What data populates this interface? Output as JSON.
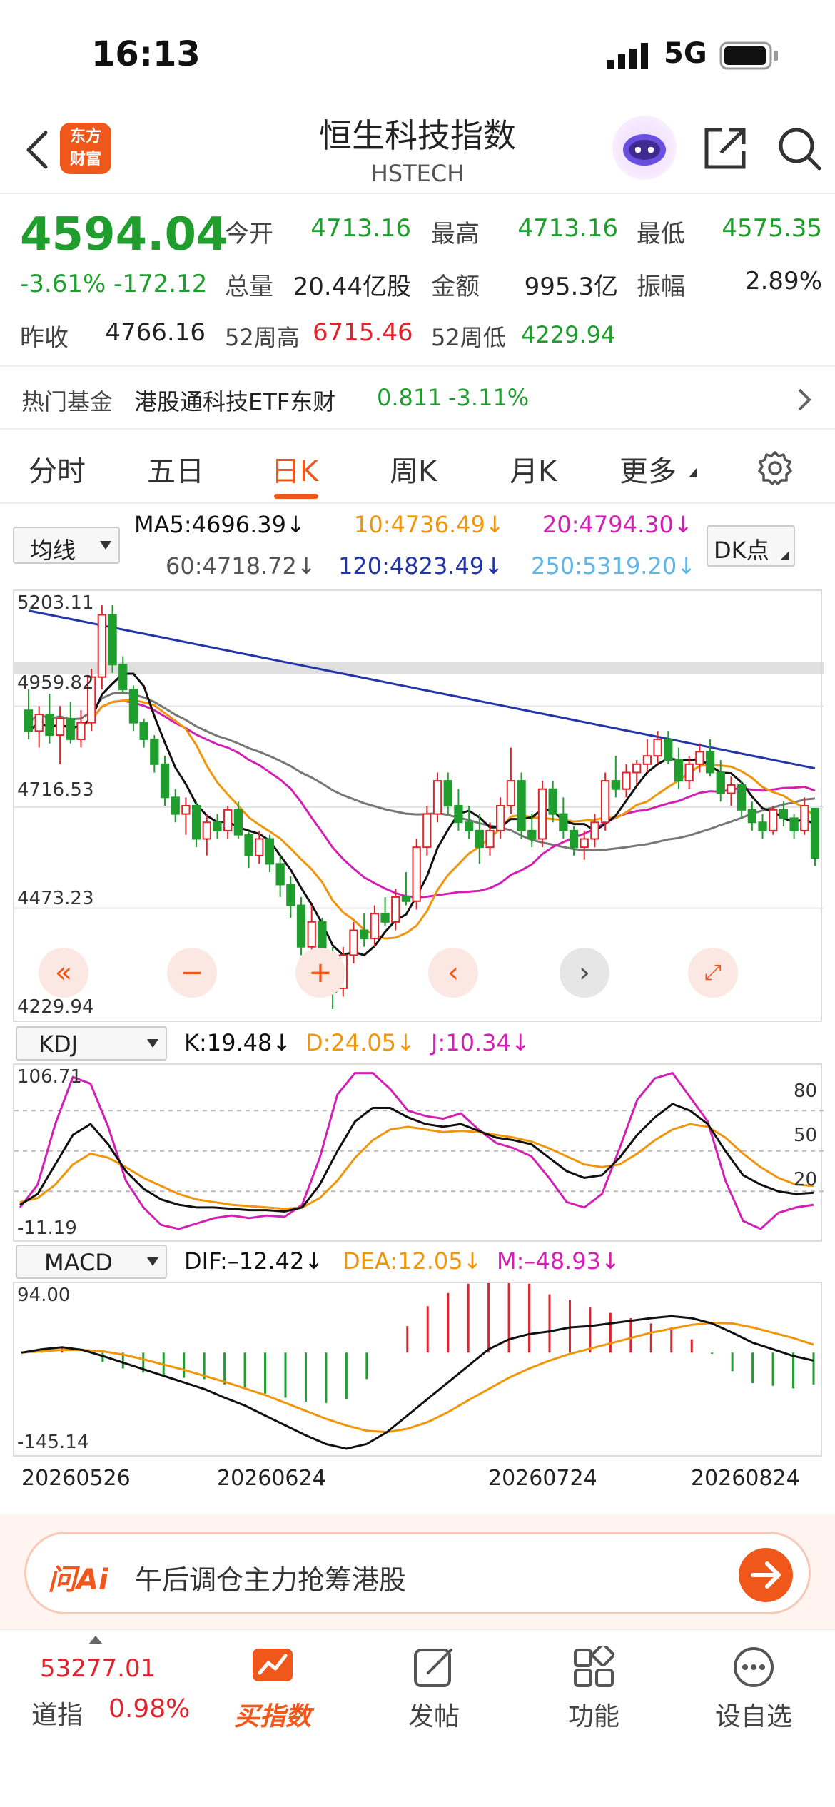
{
  "status": {
    "time": "16:13",
    "network": "5G"
  },
  "header": {
    "logo_line1": "东方",
    "logo_line2": "财富",
    "title": "恒生科技指数",
    "subtitle": "HSTECH"
  },
  "quote": {
    "price": "4594.04",
    "change": "-3.61% -172.12",
    "open_label": "今开",
    "open": "4713.16",
    "high_label": "最高",
    "high": "4713.16",
    "low_label": "最低",
    "low": "4575.35",
    "volume_label": "总量",
    "volume": "20.44亿股",
    "amount_label": "金额",
    "amount": "995.3亿",
    "amplitude_label": "振幅",
    "amplitude": "2.89%",
    "prev_close_label": "昨收",
    "prev_close": "4766.16",
    "w52_high_label": "52周高",
    "w52_high": "6715.46",
    "w52_low_label": "52周低",
    "w52_low": "4229.94"
  },
  "hot_fund": {
    "label": "热门基金",
    "name": "港股通科技ETF东财",
    "price": "0.811",
    "change": "-3.11%"
  },
  "tabs": [
    {
      "label": "分时"
    },
    {
      "label": "五日"
    },
    {
      "label": "日K"
    },
    {
      "label": "周K"
    },
    {
      "label": "月K"
    },
    {
      "label": "更多"
    }
  ],
  "ma_selector": "均线",
  "ma_values": {
    "ma5": "MA5:4696.39↓",
    "ma10": "10:4736.49↓",
    "ma20": "20:4794.30↓",
    "ma60": "60:4718.72↓",
    "ma120": "120:4823.49↓",
    "ma250": "250:5319.20↓"
  },
  "dk_button": "DK点",
  "main_axis": {
    "top": "5203.11",
    "mid_upper": "4959.82",
    "mid": "4716.53",
    "mid_lower": "4473.23",
    "bottom": "4229.94"
  },
  "kdj": {
    "selector": "KDJ",
    "k": "K:19.48↓",
    "d": "D:24.05↓",
    "j": "J:10.34↓",
    "axis_top": "106.71",
    "axis_bottom": "-11.19",
    "levels": [
      "80",
      "50",
      "20"
    ]
  },
  "macd": {
    "selector": "MACD",
    "dif": "DIF:–12.42↓",
    "dea": "DEA:12.05↓",
    "m": "M:–48.93↓",
    "axis_top": "94.00",
    "axis_bottom": "-145.14"
  },
  "dates": [
    "20260526",
    "20260624",
    "20260724",
    "20260824"
  ],
  "ai": {
    "logo": "问Ai",
    "prompt": "午后调仓主力抢筹港股"
  },
  "bottom_nav": {
    "dji_value": "53277.01",
    "dji_label": "道指",
    "dji_change": "0.98%",
    "buy_index": "买指数",
    "post": "发帖",
    "function": "功能",
    "watchlist": "设自选"
  },
  "colors": {
    "up": "#e0242b",
    "down": "#1f9e2e",
    "accent": "#f0571a",
    "ma5": "#111111",
    "ma10": "#f0960c",
    "ma20": "#d220b4",
    "ma60": "#777777",
    "ma120": "#2236a8",
    "ma250": "#5fb6e8"
  },
  "chart_data": {
    "type": "candlestick",
    "ylim": [
      4229.94,
      5203.11
    ],
    "candles": [
      {
        "o": 4950,
        "h": 5000,
        "l": 4880,
        "c": 4900
      },
      {
        "o": 4900,
        "h": 4960,
        "l": 4860,
        "c": 4940
      },
      {
        "o": 4940,
        "h": 4990,
        "l": 4870,
        "c": 4890
      },
      {
        "o": 4890,
        "h": 4960,
        "l": 4820,
        "c": 4930
      },
      {
        "o": 4930,
        "h": 4970,
        "l": 4870,
        "c": 4880
      },
      {
        "o": 4880,
        "h": 4950,
        "l": 4860,
        "c": 4920
      },
      {
        "o": 4920,
        "h": 5050,
        "l": 4900,
        "c": 5030
      },
      {
        "o": 5030,
        "h": 5203,
        "l": 5000,
        "c": 5180
      },
      {
        "o": 5180,
        "h": 5203,
        "l": 5040,
        "c": 5060
      },
      {
        "o": 5060,
        "h": 5080,
        "l": 4990,
        "c": 5000
      },
      {
        "o": 5000,
        "h": 5010,
        "l": 4900,
        "c": 4920
      },
      {
        "o": 4920,
        "h": 4930,
        "l": 4860,
        "c": 4880
      },
      {
        "o": 4880,
        "h": 4890,
        "l": 4800,
        "c": 4820
      },
      {
        "o": 4820,
        "h": 4840,
        "l": 4720,
        "c": 4740
      },
      {
        "o": 4740,
        "h": 4760,
        "l": 4680,
        "c": 4700
      },
      {
        "o": 4700,
        "h": 4740,
        "l": 4650,
        "c": 4720
      },
      {
        "o": 4720,
        "h": 4730,
        "l": 4620,
        "c": 4640
      },
      {
        "o": 4640,
        "h": 4700,
        "l": 4600,
        "c": 4680
      },
      {
        "o": 4680,
        "h": 4700,
        "l": 4640,
        "c": 4660
      },
      {
        "o": 4660,
        "h": 4720,
        "l": 4640,
        "c": 4710
      },
      {
        "o": 4710,
        "h": 4730,
        "l": 4640,
        "c": 4650
      },
      {
        "o": 4650,
        "h": 4660,
        "l": 4570,
        "c": 4600
      },
      {
        "o": 4600,
        "h": 4660,
        "l": 4580,
        "c": 4640
      },
      {
        "o": 4640,
        "h": 4650,
        "l": 4560,
        "c": 4580
      },
      {
        "o": 4580,
        "h": 4600,
        "l": 4500,
        "c": 4530
      },
      {
        "o": 4530,
        "h": 4550,
        "l": 4450,
        "c": 4480
      },
      {
        "o": 4480,
        "h": 4500,
        "l": 4360,
        "c": 4380
      },
      {
        "o": 4380,
        "h": 4480,
        "l": 4360,
        "c": 4440
      },
      {
        "o": 4440,
        "h": 4450,
        "l": 4330,
        "c": 4350
      },
      {
        "o": 4350,
        "h": 4380,
        "l": 4230,
        "c": 4270
      },
      {
        "o": 4280,
        "h": 4380,
        "l": 4260,
        "c": 4360
      },
      {
        "o": 4360,
        "h": 4440,
        "l": 4340,
        "c": 4420
      },
      {
        "o": 4420,
        "h": 4460,
        "l": 4380,
        "c": 4400
      },
      {
        "o": 4400,
        "h": 4480,
        "l": 4380,
        "c": 4460
      },
      {
        "o": 4460,
        "h": 4500,
        "l": 4430,
        "c": 4440
      },
      {
        "o": 4440,
        "h": 4520,
        "l": 4420,
        "c": 4500
      },
      {
        "o": 4500,
        "h": 4560,
        "l": 4480,
        "c": 4490
      },
      {
        "o": 4490,
        "h": 4640,
        "l": 4470,
        "c": 4620
      },
      {
        "o": 4620,
        "h": 4720,
        "l": 4600,
        "c": 4700
      },
      {
        "o": 4700,
        "h": 4800,
        "l": 4680,
        "c": 4780
      },
      {
        "o": 4780,
        "h": 4800,
        "l": 4700,
        "c": 4720
      },
      {
        "o": 4720,
        "h": 4760,
        "l": 4660,
        "c": 4680
      },
      {
        "o": 4680,
        "h": 4720,
        "l": 4640,
        "c": 4660
      },
      {
        "o": 4660,
        "h": 4700,
        "l": 4580,
        "c": 4620
      },
      {
        "o": 4620,
        "h": 4680,
        "l": 4600,
        "c": 4660
      },
      {
        "o": 4660,
        "h": 4740,
        "l": 4640,
        "c": 4720
      },
      {
        "o": 4720,
        "h": 4860,
        "l": 4700,
        "c": 4780
      },
      {
        "o": 4780,
        "h": 4800,
        "l": 4640,
        "c": 4660
      },
      {
        "o": 4660,
        "h": 4700,
        "l": 4620,
        "c": 4640
      },
      {
        "o": 4640,
        "h": 4780,
        "l": 4620,
        "c": 4760
      },
      {
        "o": 4760,
        "h": 4780,
        "l": 4680,
        "c": 4700
      },
      {
        "o": 4700,
        "h": 4740,
        "l": 4640,
        "c": 4660
      },
      {
        "o": 4660,
        "h": 4670,
        "l": 4600,
        "c": 4620
      },
      {
        "o": 4620,
        "h": 4660,
        "l": 4590,
        "c": 4640
      },
      {
        "o": 4640,
        "h": 4700,
        "l": 4620,
        "c": 4680
      },
      {
        "o": 4680,
        "h": 4800,
        "l": 4660,
        "c": 4780
      },
      {
        "o": 4780,
        "h": 4840,
        "l": 4740,
        "c": 4760
      },
      {
        "o": 4760,
        "h": 4820,
        "l": 4740,
        "c": 4800
      },
      {
        "o": 4800,
        "h": 4830,
        "l": 4770,
        "c": 4820
      },
      {
        "o": 4820,
        "h": 4880,
        "l": 4800,
        "c": 4840
      },
      {
        "o": 4840,
        "h": 4900,
        "l": 4820,
        "c": 4880
      },
      {
        "o": 4880,
        "h": 4900,
        "l": 4820,
        "c": 4830
      },
      {
        "o": 4830,
        "h": 4860,
        "l": 4760,
        "c": 4780
      },
      {
        "o": 4780,
        "h": 4840,
        "l": 4760,
        "c": 4820
      },
      {
        "o": 4820,
        "h": 4870,
        "l": 4800,
        "c": 4850
      },
      {
        "o": 4850,
        "h": 4880,
        "l": 4790,
        "c": 4800
      },
      {
        "o": 4800,
        "h": 4830,
        "l": 4730,
        "c": 4750
      },
      {
        "o": 4750,
        "h": 4790,
        "l": 4720,
        "c": 4770
      },
      {
        "o": 4770,
        "h": 4780,
        "l": 4690,
        "c": 4710
      },
      {
        "o": 4710,
        "h": 4730,
        "l": 4660,
        "c": 4680
      },
      {
        "o": 4680,
        "h": 4700,
        "l": 4640,
        "c": 4660
      },
      {
        "o": 4660,
        "h": 4720,
        "l": 4650,
        "c": 4710
      },
      {
        "o": 4710,
        "h": 4730,
        "l": 4670,
        "c": 4690
      },
      {
        "o": 4690,
        "h": 4700,
        "l": 4640,
        "c": 4660
      },
      {
        "o": 4660,
        "h": 4740,
        "l": 4650,
        "c": 4720
      },
      {
        "o": 4713,
        "h": 4713,
        "l": 4575,
        "c": 4594
      }
    ],
    "kdj": {
      "ylim": [
        -11.19,
        106.71
      ],
      "k": [
        10,
        18,
        40,
        62,
        70,
        55,
        35,
        22,
        14,
        10,
        8,
        8,
        7,
        6,
        6,
        5,
        8,
        25,
        50,
        72,
        82,
        82,
        75,
        70,
        68,
        70,
        65,
        60,
        58,
        55,
        45,
        35,
        30,
        32,
        45,
        62,
        75,
        85,
        80,
        70,
        50,
        32,
        25,
        20,
        18,
        19
      ],
      "d": [
        12,
        15,
        25,
        40,
        48,
        45,
        38,
        30,
        24,
        18,
        14,
        12,
        10,
        9,
        8,
        7,
        8,
        15,
        28,
        45,
        58,
        66,
        68,
        66,
        64,
        65,
        64,
        62,
        60,
        57,
        52,
        46,
        40,
        38,
        40,
        48,
        58,
        66,
        70,
        68,
        60,
        48,
        38,
        30,
        25,
        24
      ],
      "j": [
        8,
        25,
        70,
        105,
        100,
        68,
        28,
        8,
        -5,
        -8,
        -4,
        0,
        2,
        0,
        2,
        1,
        10,
        45,
        92,
        108,
        108,
        96,
        80,
        76,
        74,
        78,
        66,
        56,
        52,
        46,
        30,
        12,
        8,
        18,
        52,
        88,
        104,
        108,
        90,
        72,
        28,
        -2,
        -8,
        4,
        8,
        10
      ]
    },
    "macd": {
      "ylim": [
        -145.14,
        94.0
      ],
      "dif": [
        0,
        5,
        8,
        4,
        -5,
        -15,
        -25,
        -35,
        -45,
        -55,
        -68,
        -80,
        -95,
        -110,
        -125,
        -138,
        -145,
        -138,
        -120,
        -95,
        -70,
        -45,
        -20,
        5,
        20,
        28,
        32,
        38,
        40,
        44,
        48,
        52,
        55,
        52,
        44,
        30,
        15,
        5,
        -5,
        -12
      ],
      "dea": [
        0,
        2,
        4,
        4,
        2,
        -3,
        -10,
        -18,
        -26,
        -35,
        -44,
        -54,
        -64,
        -76,
        -88,
        -100,
        -110,
        -118,
        -120,
        -115,
        -105,
        -90,
        -72,
        -55,
        -38,
        -24,
        -12,
        -2,
        6,
        14,
        22,
        30,
        36,
        42,
        45,
        44,
        38,
        30,
        22,
        12
      ],
      "m": [
        0,
        6,
        8,
        0,
        -14,
        -24,
        -30,
        -34,
        -38,
        -40,
        -48,
        -52,
        -62,
        -68,
        -74,
        -76,
        -70,
        -40,
        0,
        40,
        70,
        90,
        104,
        120,
        116,
        104,
        88,
        80,
        68,
        60,
        52,
        44,
        38,
        20,
        -2,
        -28,
        -46,
        -50,
        -54,
        -48
      ]
    }
  }
}
